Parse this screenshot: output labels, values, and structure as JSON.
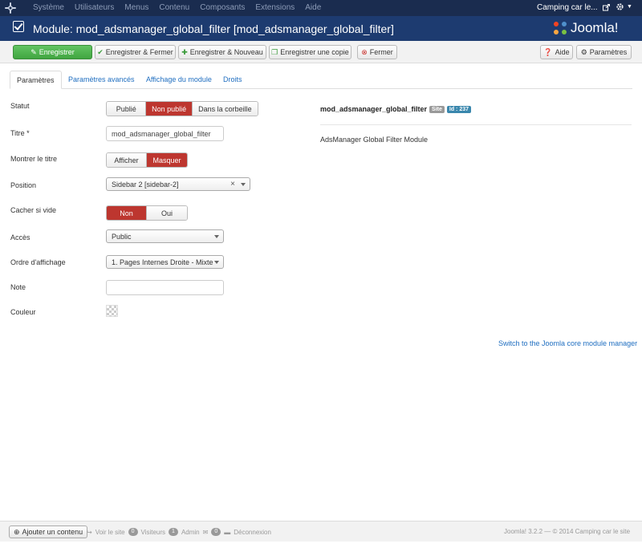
{
  "topnav": {
    "menu": [
      "Système",
      "Utilisateurs",
      "Menus",
      "Contenu",
      "Composants",
      "Extensions",
      "Aide"
    ],
    "site_name": "Camping car le...",
    "icons": {
      "logo": "joomla-icon",
      "external": "external-link-icon",
      "settings": "gear-icon"
    }
  },
  "titlebar": {
    "title": "Module: mod_adsmanager_global_filter [mod_adsmanager_global_filter]",
    "brand": "Joomla!"
  },
  "toolbar": {
    "save": "Enregistrer",
    "save_close": "Enregistrer & Fermer",
    "save_new": "Enregistrer & Nouveau",
    "save_copy": "Enregistrer une copie",
    "close": "Fermer",
    "help": "Aide",
    "options": "Paramètres"
  },
  "tabs": [
    "Paramètres",
    "Paramètres avancés",
    "Affichage du module",
    "Droits"
  ],
  "form": {
    "status": {
      "label": "Statut",
      "options": [
        "Publié",
        "Non publié",
        "Dans la corbeille"
      ],
      "selected": "Non publié"
    },
    "title": {
      "label": "Titre *",
      "value": "mod_adsmanager_global_filter"
    },
    "show_title": {
      "label": "Montrer le titre",
      "options": [
        "Afficher",
        "Masquer"
      ],
      "selected": "Masquer"
    },
    "position": {
      "label": "Position",
      "value": "Sidebar 2 [sidebar-2]"
    },
    "hide_empty": {
      "label": "Cacher si vide",
      "options": [
        "Non",
        "Oui"
      ],
      "selected": "Non"
    },
    "access": {
      "label": "Accès",
      "value": "Public"
    },
    "ordering": {
      "label": "Ordre d'affichage",
      "value": "1. Pages Internes Droite - Mixte"
    },
    "note": {
      "label": "Note",
      "value": ""
    },
    "color": {
      "label": "Couleur"
    }
  },
  "module_info": {
    "name": "mod_adsmanager_global_filter",
    "badge_site": "Site",
    "badge_id": "Id : 237",
    "description": "AdsManager Global Filter Module"
  },
  "switch_link": "Switch to the Joomla core module manager",
  "statusbar": {
    "add_content": "Ajouter un contenu",
    "view_site": "Voir le site",
    "visitors_count": "0",
    "visitors_label": "Visiteurs",
    "admin_count": "1",
    "admin_label": "Admin",
    "messages_count": "0",
    "logout": "Déconnexion",
    "copyright": "Joomla! 3.2.2  —  © 2014 Camping car le site"
  },
  "colors": {
    "nav_bg": "#1a2c4f",
    "title_bg": "#1d3b70",
    "active_red": "#bd362f",
    "save_green": "#51b351",
    "link_blue": "#1f6ec0"
  }
}
